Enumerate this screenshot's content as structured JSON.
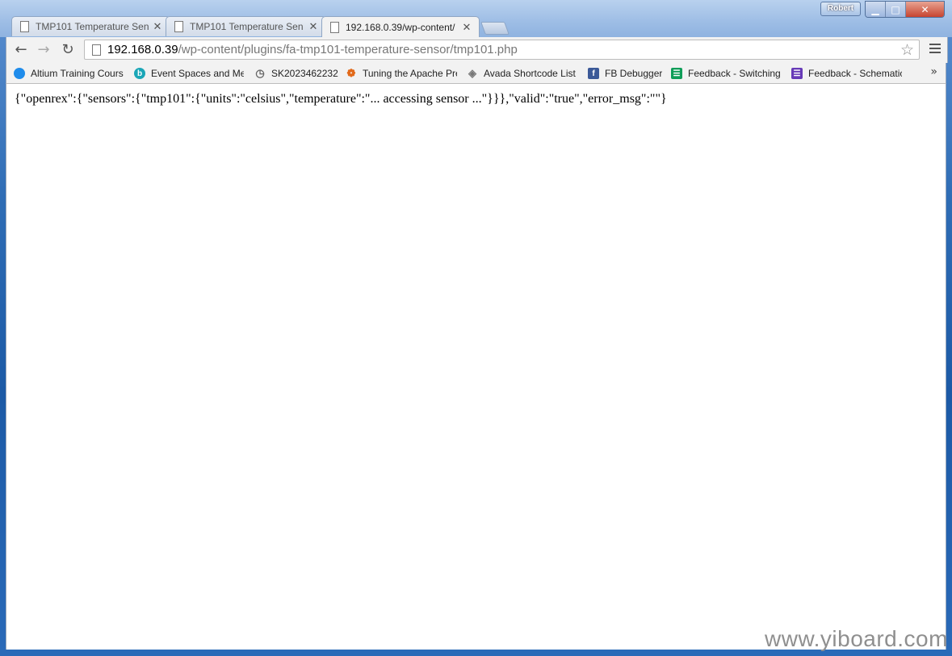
{
  "window": {
    "user_badge": "Robert",
    "controls": {
      "minimize": "▁",
      "maximize": "□",
      "close": "✕"
    }
  },
  "tabs": [
    {
      "label": "TMP101 Temperature Sen",
      "active": false
    },
    {
      "label": "TMP101 Temperature Sen",
      "active": false
    },
    {
      "label": "192.168.0.39/wp-content/",
      "active": true
    }
  ],
  "toolbar": {
    "url_host": "192.168.0.39",
    "url_path": "/wp-content/plugins/fa-tmp101-temperature-sensor/tmp101.php"
  },
  "bookmarks": [
    {
      "label": "Altium Training Cours",
      "icon": "cloud-icon",
      "color": "#1f8ceb"
    },
    {
      "label": "Event Spaces and Mee",
      "icon": "b-badge-icon",
      "color": "#1aa6b7"
    },
    {
      "label": "SK2023462232",
      "icon": "history-icon",
      "color": "#777777"
    },
    {
      "label": "Tuning the Apache Pre",
      "icon": "apache-icon",
      "color": "#e26a1b"
    },
    {
      "label": "Avada Shortcode List",
      "icon": "avada-icon",
      "color": "#777777"
    },
    {
      "label": "FB Debugger",
      "icon": "facebook-icon",
      "color": "#3b5998"
    },
    {
      "label": "Feedback - Switching",
      "icon": "sheets-icon",
      "color": "#0f9d58"
    },
    {
      "label": "Feedback - Schematic",
      "icon": "forms-icon",
      "color": "#673ab7"
    }
  ],
  "page": {
    "json_text": "{\"openrex\":{\"sensors\":{\"tmp101\":{\"units\":\"celsius\",\"temperature\":\"... accessing sensor ...\"}}},\"valid\":\"true\",\"error_msg\":\"\"}"
  },
  "watermark": "www.yiboard.com"
}
